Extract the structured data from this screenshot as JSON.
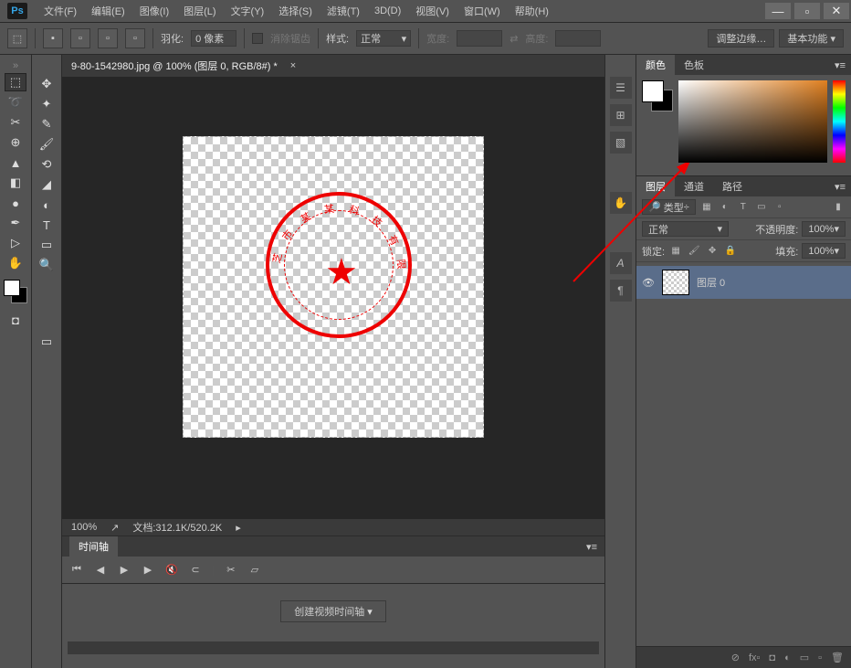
{
  "menu": {
    "file": "文件(F)",
    "edit": "编辑(E)",
    "image": "图像(I)",
    "layer": "图层(L)",
    "text": "文字(Y)",
    "select": "选择(S)",
    "filter": "滤镜(T)",
    "threed": "3D(D)",
    "view": "视图(V)",
    "window": "窗口(W)",
    "help": "帮助(H)"
  },
  "optbar": {
    "feather_label": "羽化:",
    "feather_value": "0 像素",
    "antialias": "消除锯齿",
    "style_label": "样式:",
    "style_value": "正常",
    "width_label": "宽度:",
    "height_label": "高度:",
    "refine": "调整边缘…",
    "workspace": "基本功能"
  },
  "doc": {
    "tab": "9-80-1542980.jpg @ 100% (图层 0, RGB/8#) *",
    "close": "×"
  },
  "stamp_text": "芝 市 某 某 科 技 有 限 公 司",
  "status": {
    "zoom": "100%",
    "doc_label": "文档:",
    "doc_size": "312.1K/520.2K"
  },
  "timeline": {
    "tab": "时间轴",
    "create": "创建视频时间轴"
  },
  "color_panel": {
    "tab_color": "颜色",
    "tab_swatch": "色板"
  },
  "layers": {
    "tab_layer": "图层",
    "tab_channel": "通道",
    "tab_path": "路径",
    "kind": "类型",
    "blend": "正常",
    "opacity_label": "不透明度:",
    "opacity": "100%",
    "lock_label": "锁定:",
    "fill_label": "填充:",
    "fill": "100%",
    "layer0": "图层 0"
  },
  "icons": {
    "marquee": "⬚",
    "move": "✥",
    "lasso": "➰",
    "wand": "✦",
    "crop": "✂",
    "eyedrop": "✎",
    "heal": "⊕",
    "brush": "🖌",
    "stamp": "▲",
    "history": "⟲",
    "eraser": "◧",
    "fill": "◢",
    "blur": "●",
    "dodge": "◐",
    "pen": "✒",
    "type": "T",
    "path": "▷",
    "shape": "▭",
    "hand": "✋",
    "zoom": "🔍",
    "search": "🔎",
    "filter_ico": "⊞"
  }
}
